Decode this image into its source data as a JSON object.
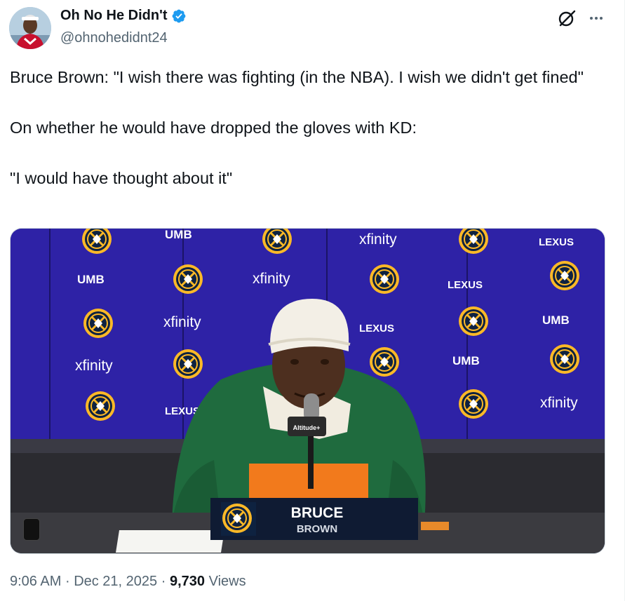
{
  "author": {
    "display_name": "Oh No He Didn't",
    "handle": "@ohnohedidnt24",
    "verified": true,
    "avatar_icon": "player-avatar"
  },
  "header_actions": {
    "grok_icon": "grok-icon",
    "more_icon": "more-options-icon"
  },
  "tweet": {
    "paragraphs": [
      "Bruce Brown: \"I wish there was fighting (in the NBA). I wish we didn't get fined\"",
      "On whether he would have dropped the gloves with KD:",
      "\"I would have thought about it\""
    ]
  },
  "media": {
    "backdrop_sponsors": [
      "UMB",
      "xfinity",
      "LEXUS"
    ],
    "nameplate": {
      "first": "BRUCE",
      "last": "BROWN"
    },
    "mic_flag": "Altitude+"
  },
  "footer": {
    "time": "9:06 AM",
    "separator": "·",
    "date": "Dec 21, 2025",
    "views_count": "9,730",
    "views_label": "Views"
  },
  "colors": {
    "verified_blue": "#1d9bf0",
    "secondary_text": "#536471",
    "backdrop_blue": "#2a1d8f",
    "nuggets_gold": "#fdb927",
    "nuggets_navy": "#0e2240"
  }
}
